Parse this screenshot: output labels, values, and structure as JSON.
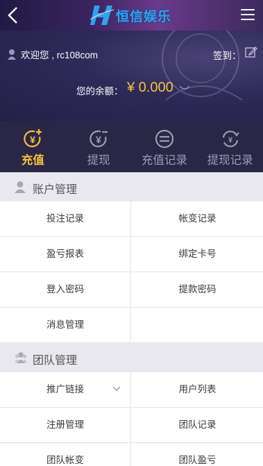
{
  "header": {
    "logo_text": "恒信娱乐",
    "back_icon": "chevron-left-icon",
    "menu_icon": "hamburger-menu-icon"
  },
  "user": {
    "welcome": "欢迎您 , rc108com",
    "signin_label": "签到：",
    "balance_label": "您的余额：",
    "balance_value": "¥ 0.000"
  },
  "actions": [
    {
      "label": "充值",
      "icon": "recharge-yuan-plus-icon",
      "active": true
    },
    {
      "label": "提现",
      "icon": "withdraw-yuan-minus-icon",
      "active": false
    },
    {
      "label": "充值记录",
      "icon": "recharge-record-icon",
      "active": false
    },
    {
      "label": "提现记录",
      "icon": "withdraw-record-icon",
      "active": false
    }
  ],
  "account_section": {
    "title": "账户管理",
    "items": [
      "投注记录",
      "帐变记录",
      "盈亏报表",
      "绑定卡号",
      "登入密码",
      "提款密码",
      "消息管理"
    ]
  },
  "team_section": {
    "title": "团队管理",
    "items": [
      "推广链接",
      "用户列表",
      "注册管理",
      "团队记录",
      "团队帐变",
      "团队盈亏"
    ]
  },
  "colors": {
    "accent": "#f5c23c",
    "header_bg": "#2a2746",
    "logo": "#2fa2ef"
  }
}
